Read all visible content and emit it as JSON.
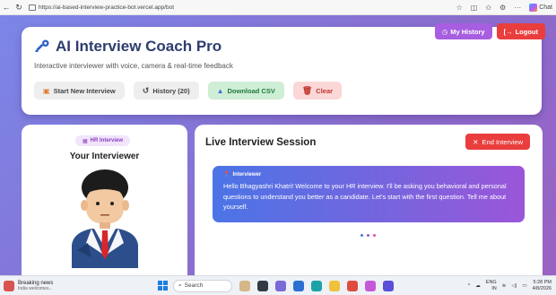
{
  "browser": {
    "url": "https://ai-based-interview-practice-bot.vercel.app/bot",
    "chat_label": "Chat"
  },
  "header": {
    "title": "AI Interview Coach Pro",
    "subtitle": "Interactive interviewer with voice, camera & real-time feedback",
    "my_history_label": "My History",
    "logout_label": "Logout",
    "buttons": {
      "start_new": "Start New Interview",
      "history": "History (20)",
      "download_csv": "Download CSV",
      "clear": "Clear"
    }
  },
  "interviewer_panel": {
    "badge": "HR Interview",
    "title": "Your Interviewer"
  },
  "session": {
    "title": "Live Interview Session",
    "end_label": "End Interview",
    "message_sender": "Interviewer",
    "message_text": "Hello Bhagyashri Khatri! Welcome to your HR interview. I'll be asking you behavioral and personal questions to understand you better as a candidate. Let's start with the first question. Tell me about yourself."
  },
  "taskbar": {
    "news_title": "Breaking news",
    "news_sub": "India welcomes...",
    "search_placeholder": "Search",
    "lang": "ENG",
    "lang_sub": "IN",
    "time": "5:28 PM",
    "date": "4/8/2026"
  },
  "colors": {
    "accent_purple": "#a75ee0",
    "danger_red": "#ea3e3e",
    "title_navy": "#2d3d6e",
    "bubble_start": "#4b74e6",
    "bubble_end": "#9b56d9",
    "typing_dots": [
      "#4b74e6",
      "#9b56d9",
      "#e0529c"
    ]
  },
  "icons": {
    "title": "key-icon",
    "my_history": "clock-icon",
    "logout": "logout-icon",
    "start_new": "play-icon",
    "history": "history-icon",
    "download": "flask-icon",
    "clear": "trash-icon",
    "badge": "briefcase-icon",
    "end": "close-icon",
    "interviewer": "pin-icon"
  }
}
